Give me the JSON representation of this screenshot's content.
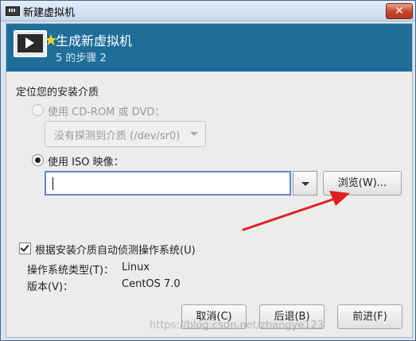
{
  "window": {
    "title": "新建虚拟机",
    "close_label": "✕"
  },
  "banner": {
    "title": "生成新虚拟机",
    "step": "5 的步骤 2"
  },
  "media": {
    "heading": "定位您的安装介质",
    "cdrom_label": "使用 CD-ROM 或 DVD：",
    "cdrom_combo_value": "没有探测到介质 (/dev/sr0)",
    "iso_label": "使用 ISO 映像：",
    "iso_input_value": "",
    "browse_label": "浏览(W)..."
  },
  "os": {
    "autodetect_label": "根据安装介质自动侦测操作系统(U)",
    "autodetect_checked": true,
    "type_label": "操作系统类型(T)：",
    "type_value": "Linux",
    "version_label": "版本(V)：",
    "version_value": "CentOS 7.0"
  },
  "footer": {
    "cancel_label": "取消(C)",
    "back_label": "后退(B)",
    "forward_label": "前进(F)"
  },
  "watermark": "https://blog.csdn.net/zhangye123",
  "colors": {
    "banner": "#1f6d99",
    "annotation_arrow": "#e02020"
  },
  "icons": {
    "app": "virt-manager-icon",
    "banner": "monitor-new-vm-icon"
  }
}
